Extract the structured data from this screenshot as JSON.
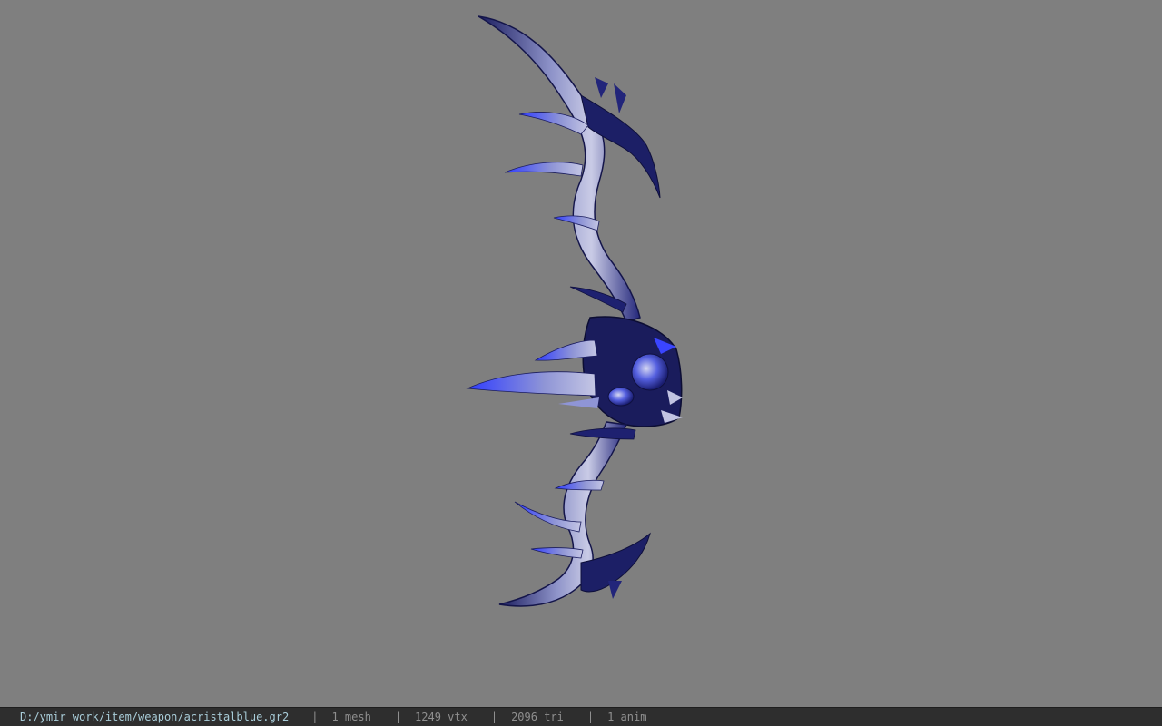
{
  "viewport": {
    "background": "#7f7f7f",
    "model": {
      "description_icon": "bow-model",
      "colors": {
        "dark": "#14154a",
        "mid": "#2b34b8",
        "light": "#b5b8dc",
        "glow": "#3a45ff"
      }
    }
  },
  "statusbar": {
    "file_path": "D:/ymir work/item/weapon/acristalblue.gr2",
    "separator": "|",
    "mesh_count": "1 mesh",
    "vertex_count": "1249 vtx",
    "triangle_count": "2096 tri",
    "anim_count": "1 anim"
  }
}
